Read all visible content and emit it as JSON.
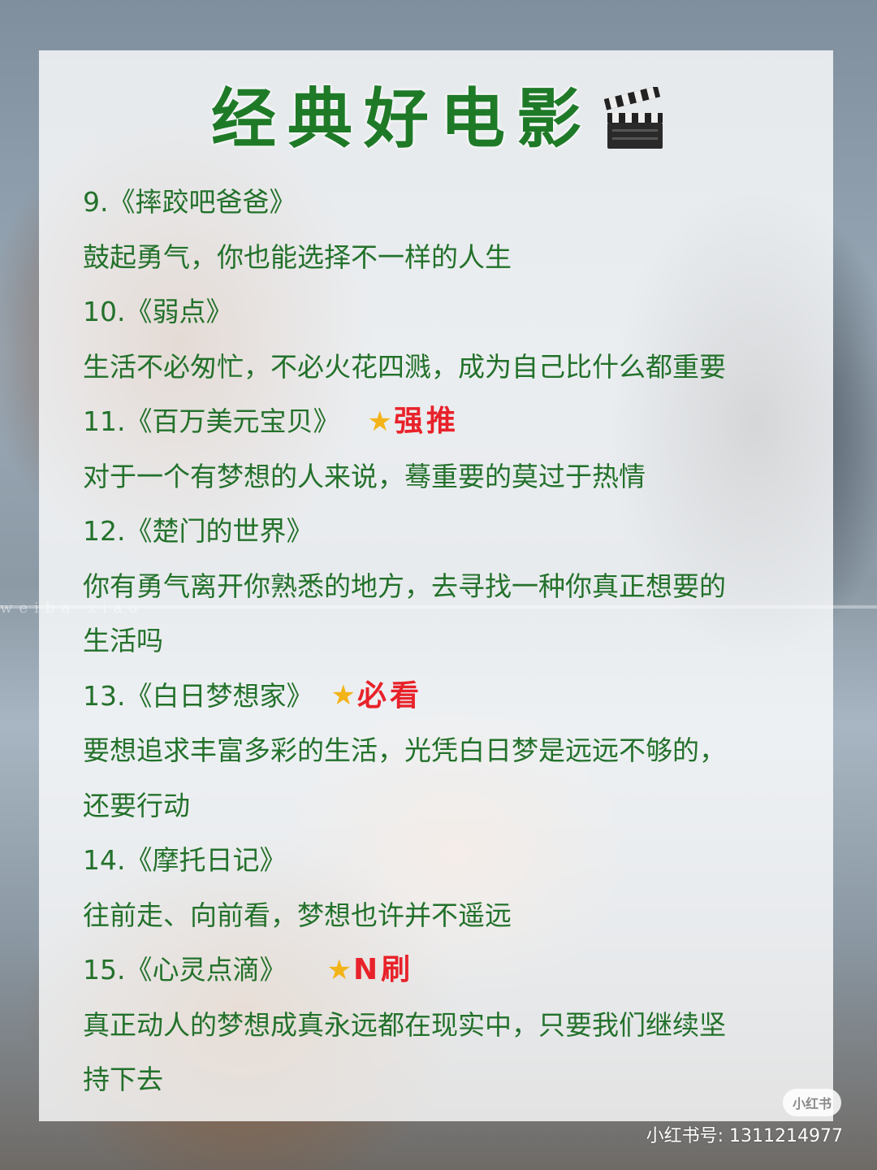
{
  "header": {
    "title": "经典好电影",
    "title_icon": "clapperboard-icon"
  },
  "colors": {
    "title": "#1f7a28",
    "body_text": "#23712b",
    "tag": "#e8222a",
    "star": "#f2b418"
  },
  "movies": [
    {
      "title": "9.《摔跤吧爸爸》",
      "tag": "",
      "desc": [
        "鼓起勇气，你也能选择不一样的人生"
      ]
    },
    {
      "title": "10.《弱点》",
      "tag": "",
      "desc": [
        "生活不必匆忙，不必火花四溅，成为自己比什么都重要"
      ]
    },
    {
      "title": "11.《百万美元宝贝》",
      "tag": "强推",
      "desc": [
        "对于一个有梦想的人来说，蓦重要的莫过于热情"
      ]
    },
    {
      "title": "12.《楚门的世界》",
      "tag": "",
      "desc": [
        "你有勇气离开你熟悉的地方，去寻找一种你真正想要的",
        "生活吗"
      ]
    },
    {
      "title": "13.《白日梦想家》",
      "tag": "必看",
      "desc": [
        "要想追求丰富多彩的生活，光凭白日梦是远远不够的，",
        "还要行动"
      ]
    },
    {
      "title": "14.《摩托日记》",
      "tag": "",
      "desc": [
        "往前走、向前看，梦想也许并不遥远"
      ]
    },
    {
      "title": "15.《心灵点滴》",
      "tag": "N刷",
      "desc": [
        "真正动人的梦想成真永远都在现实中，只要我们继续坚",
        "持下去"
      ]
    }
  ],
  "watermark": {
    "badge": "小红书",
    "id_text": "小红书号: 1311214977",
    "faint_line": "weiba  xiao"
  }
}
